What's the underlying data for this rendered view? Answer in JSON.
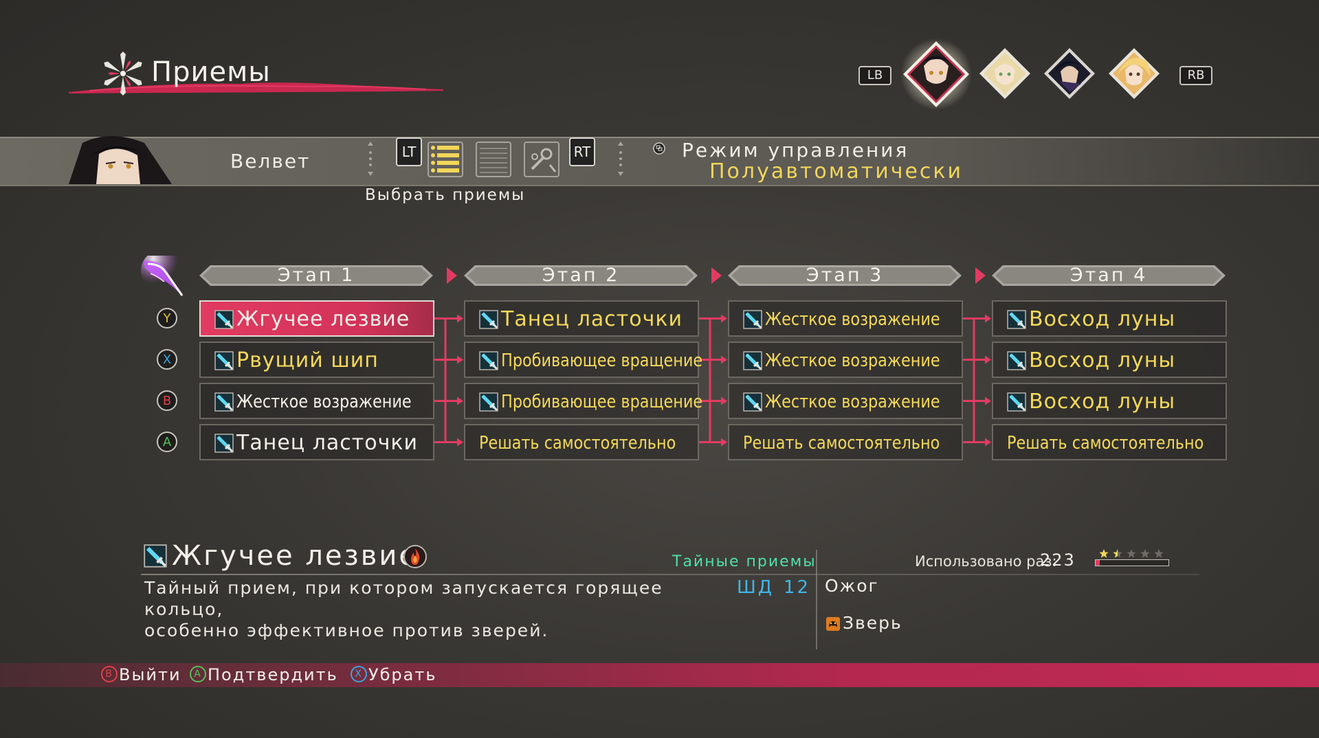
{
  "header": {
    "title": "Приемы"
  },
  "party": {
    "left_bumper": "LB",
    "right_bumper": "RB",
    "members": [
      {
        "name": "velvet-portrait",
        "selected": true
      },
      {
        "name": "laphicet-portrait",
        "selected": false
      },
      {
        "name": "rokurou-portrait",
        "selected": false
      },
      {
        "name": "magilou-portrait",
        "selected": false
      }
    ]
  },
  "character": {
    "name": "Велвет",
    "left_trigger": "LT",
    "right_trigger": "RT",
    "control_mode_label": "Режим управления",
    "control_mode_value": "Полуавтоматически",
    "select_hint": "Выбрать приемы"
  },
  "stages": [
    "Этап 1",
    "Этап 2",
    "Этап 3",
    "Этап 4"
  ],
  "buttons": [
    {
      "letter": "Y",
      "color": "#e0c23a"
    },
    {
      "letter": "X",
      "color": "#3aa6e0"
    },
    {
      "letter": "B",
      "color": "#e0404a"
    },
    {
      "letter": "A",
      "color": "#52c25a"
    }
  ],
  "grid": [
    [
      {
        "label": "Жгучее лезвие",
        "icon": "sword-icon",
        "color": "white"
      },
      {
        "label": "Танец ласточки",
        "icon": "sword-icon",
        "color": "yellow"
      },
      {
        "label": "Жесткое возражение",
        "icon": "sword-icon",
        "color": "yellow"
      },
      {
        "label": "Восход луны",
        "icon": "sword-icon",
        "color": "yellow"
      }
    ],
    [
      {
        "label": "Рвущий шип",
        "icon": "sword-icon",
        "color": "yellow"
      },
      {
        "label": "Пробивающее вращение",
        "icon": "sword-icon",
        "color": "yellow"
      },
      {
        "label": "Жесткое возражение",
        "icon": "sword-icon",
        "color": "yellow"
      },
      {
        "label": "Восход луны",
        "icon": "sword-icon",
        "color": "yellow"
      }
    ],
    [
      {
        "label": "Жесткое возражение",
        "icon": "sword-icon",
        "color": "white"
      },
      {
        "label": "Пробивающее вращение",
        "icon": "sword-icon",
        "color": "yellow"
      },
      {
        "label": "Жесткое возражение",
        "icon": "sword-icon",
        "color": "yellow"
      },
      {
        "label": "Восход луны",
        "icon": "sword-icon",
        "color": "yellow"
      }
    ],
    [
      {
        "label": "Танец ласточки",
        "icon": "sword-icon",
        "color": "white"
      },
      {
        "label": "Решать самостоятельно",
        "icon": "",
        "color": "yellow"
      },
      {
        "label": "Решать самостоятельно",
        "icon": "",
        "color": "yellow"
      },
      {
        "label": "Решать самостоятельно",
        "icon": "",
        "color": "yellow"
      }
    ]
  ],
  "selected": {
    "row": 0,
    "col": 0
  },
  "detail": {
    "name": "Жгучее лезвие",
    "category": "Тайные приемы",
    "description_line1": "Тайный прием, при котором запускается горящее кольцо,",
    "description_line2": "особенно эффективное против зверей.",
    "sd_label": "ШД",
    "sd_value": "12",
    "effect": "Ожог",
    "target": "Зверь",
    "usage_label": "Использовано раз:",
    "usage_count": "223",
    "stars_filled": 1.5,
    "stars_total": 5,
    "usage_progress": 0.06
  },
  "footer": [
    {
      "btn": "B",
      "color": "#e0404a",
      "label": "Выйти"
    },
    {
      "btn": "A",
      "color": "#52c25a",
      "label": "Подтвердить"
    },
    {
      "btn": "X",
      "color": "#3aa6e0",
      "label": "Убрать"
    }
  ],
  "colors": {
    "accent": "#e23b62",
    "label_yellow": "#f4d95a",
    "category_green": "#4fe0a8",
    "sd_blue": "#3fb6e8"
  }
}
